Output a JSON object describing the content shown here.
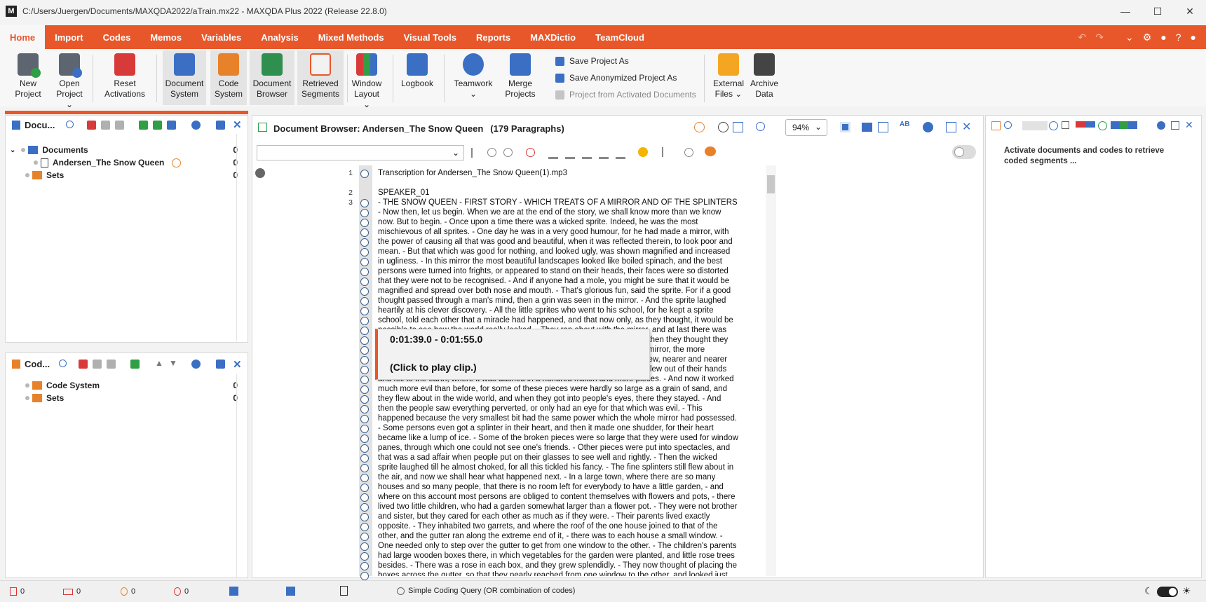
{
  "window": {
    "logo": "M",
    "title": "C:/Users/Juergen/Documents/MAXQDA2022/aTrain.mx22 - MAXQDA Plus 2022 (Release 22.8.0)"
  },
  "menu": [
    "Home",
    "Import",
    "Codes",
    "Memos",
    "Variables",
    "Analysis",
    "Mixed Methods",
    "Visual Tools",
    "Reports",
    "MAXDictio",
    "TeamCloud"
  ],
  "ribbon": {
    "new_project": [
      "New",
      "Project"
    ],
    "open_project": [
      "Open",
      "Project"
    ],
    "reset_activations": [
      "Reset",
      "Activations"
    ],
    "document_system": [
      "Document",
      "System"
    ],
    "code_system": [
      "Code",
      "System"
    ],
    "document_browser": [
      "Document",
      "Browser"
    ],
    "retrieved_segments": [
      "Retrieved",
      "Segments"
    ],
    "window_layout": [
      "Window",
      "Layout"
    ],
    "logbook": "Logbook",
    "teamwork": "Teamwork",
    "merge_projects": [
      "Merge",
      "Projects"
    ],
    "save_project_as": "Save Project As",
    "save_anonymized_project_as": "Save Anonymized Project As",
    "project_from_activated_documents": "Project from Activated Documents",
    "external_files": [
      "External",
      "Files"
    ],
    "archive_data": [
      "Archive",
      "Data"
    ]
  },
  "documents_panel": {
    "title": "Docu...",
    "rows": [
      {
        "label": "Documents",
        "count": "0"
      },
      {
        "label": "Andersen_The Snow Queen",
        "count": "0"
      },
      {
        "label": "Sets",
        "count": "0"
      }
    ]
  },
  "codes_panel": {
    "title": "Cod...",
    "rows": [
      {
        "label": "Code System",
        "count": "0"
      },
      {
        "label": "Sets",
        "count": "0"
      }
    ]
  },
  "document_browser": {
    "title": "Document Browser: Andersen_The Snow Queen",
    "paragraphs": "(179 Paragraphs)",
    "zoom": "94%",
    "para_numbers": [
      "1",
      "2",
      "3"
    ],
    "lines": [
      "Transcription for Andersen_The Snow Queen(1).mp3",
      "",
      "SPEAKER_01",
      "- THE SNOW QUEEN - FIRST STORY - WHICH TREATS OF A MIRROR AND OF THE SPLINTERS",
      "- Now then, let us begin. When we are at the end of the story, we shall know more than we know",
      "now. But to begin. - Once upon a time there was a wicked sprite. Indeed, he was the most",
      "mischievous of all sprites. - One day he was in a very good humour, for he had made a mirror, with",
      "the power of causing all that was good and beautiful, when it was reflected therein, to look poor and",
      "mean. - But that which was good for nothing, and looked ugly, was shown magnified and increased",
      "in ugliness. - In this mirror the most beautiful landscapes looked like boiled spinach, and the best",
      "persons were turned into frights, or appeared to stand on their heads, their faces were so distorted",
      "that they were not to be recognised. - And if anyone had a mole, you might be sure that it would be",
      "magnified and spread over both nose and mouth. - That's glorious fun, said the sprite. For if a good",
      "thought passed through a man's mind, then a grin was seen in the mirror. - And the sprite laughed",
      "heartily at his clever discovery. - All the little sprites who went to his school, for he kept a sprite",
      "school, told each other that a miracle had happened, and that now only, as they thought, it would be",
      "possible to see how the world really looked. - They ran about with the mirror, and at last there was",
      "not a land or a person who was not represented distorted in the mirror. - So then they thought they",
      "would fly up to the sky, and have a joke there. The higher they flew with the mirror, the more",
      "terribly it grinned: they could hardly hold it fast. Higher and higher still they flew, nearer and nearer",
      "to the stars, when suddenly the mirror shook so terribly with grinning, that it flew out of their hands",
      "and fell to the earth, where it was dashed in a hundred million and more pieces. - And now it worked",
      "much more evil than before, for some of these pieces were hardly so large as a grain of sand, and",
      "they flew about in the wide world, and when they got into people's eyes, there they stayed. - And",
      "then the people saw everything perverted, or only had an eye for that which was evil. - This",
      "happened because the very smallest bit had the same power which the whole mirror had possessed.",
      "- Some persons even got a splinter in their heart, and then it made one shudder, for their heart",
      "became like a lump of ice. - Some of the broken pieces were so large that they were used for window",
      "panes, through which one could not see one's friends. - Other pieces were put into spectacles, and",
      "that was a sad affair when people put on their glasses to see well and rightly. - Then the wicked",
      "sprite laughed till he almost choked, for all this tickled his fancy. - The fine splinters still flew about in",
      "the air, and now we shall hear what happened next. - In a large town, where there are so many",
      "houses and so many people, that there is no room left for everybody to have a little garden, - and",
      "where on this account most persons are obliged to content themselves with flowers and pots, - there",
      "lived two little children, who had a garden somewhat larger than a flower pot. - They were not brother",
      "and sister, but they cared for each other as much as if they were. - Their parents lived exactly",
      "opposite. - They inhabited two garrets, and where the roof of the one house joined to that of the",
      "other, and the gutter ran along the extreme end of it, - there was to each house a small window. -",
      "One needed only to step over the gutter to get from one window to the other. - The children's parents",
      "had large wooden boxes there, in which vegetables for the garden were planted, and little rose trees",
      "besides. - There was a rose in each box, and they grew splendidly. - They now thought of placing the",
      "boxes across the gutter, so that they nearly reached from one window to the other, and looked just"
    ],
    "tooltip": {
      "time": "0:01:39.0 - 0:01:55.0",
      "action": "(Click to play clip.)"
    }
  },
  "retrieved_panel": {
    "message": "Activate documents and codes to retrieve coded segments ..."
  },
  "statusbar": {
    "counts": [
      "0",
      "0",
      "0",
      "0"
    ],
    "query": "Simple Coding Query (OR combination of codes)"
  },
  "colors": {
    "accent": "#e8572a",
    "blue": "#3a6fc4"
  }
}
